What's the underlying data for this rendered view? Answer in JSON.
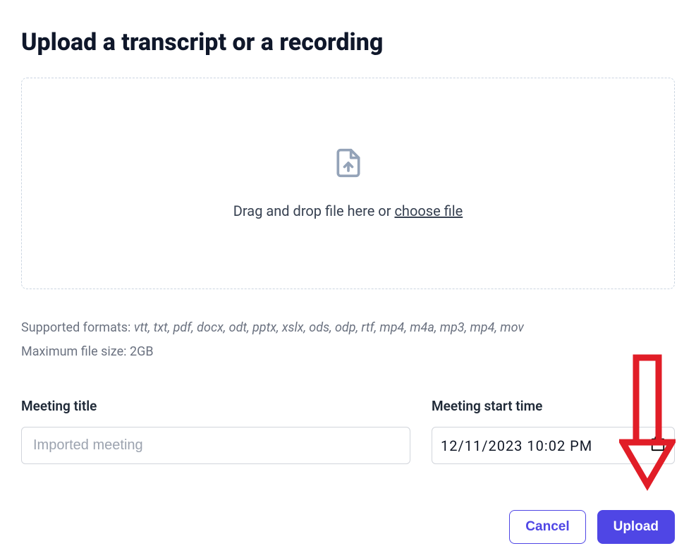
{
  "title": "Upload a transcript or a recording",
  "dropzone": {
    "prompt_prefix": "Drag and drop file here or ",
    "choose_file": "choose file"
  },
  "formats_label": "Supported formats: ",
  "formats_list": "vtt, txt, pdf, docx, odt, pptx, xslx, ods, odp, rtf, mp4, m4a, mp3, mp4, mov",
  "max_size_label": "Maximum file size: ",
  "max_size_value": "2GB",
  "fields": {
    "title_label": "Meeting title",
    "title_placeholder": "Imported meeting",
    "datetime_label": "Meeting start time",
    "datetime_value": "12/11/2023 10:02 PM"
  },
  "buttons": {
    "cancel": "Cancel",
    "upload": "Upload"
  },
  "annotation": {
    "arrow_target": "upload-button"
  }
}
